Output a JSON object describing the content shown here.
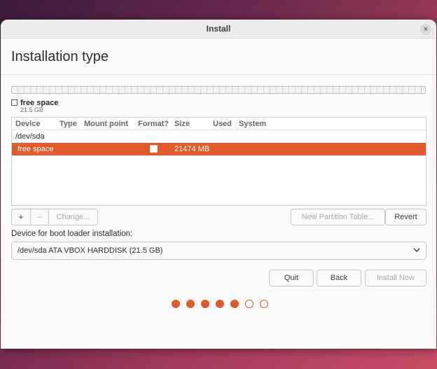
{
  "window": {
    "title": "Install",
    "close_glyph": "×"
  },
  "page": {
    "title": "Installation type"
  },
  "disk_legend": {
    "label": "free space",
    "size": "21.5 GB"
  },
  "partition_table": {
    "columns": [
      "Device",
      "Type",
      "Mount point",
      "Format?",
      "Size",
      "Used",
      "System"
    ],
    "device": "/dev/sda",
    "rows": [
      {
        "device": "free space",
        "type": "",
        "mount_point": "",
        "format": false,
        "size": "21474 MB",
        "used": "",
        "system": "",
        "selected": true
      }
    ]
  },
  "partition_buttons": {
    "add": "+",
    "remove": "–",
    "change": "Change...",
    "new_table": "New Partition Table...",
    "revert": "Revert"
  },
  "boot_loader": {
    "label": "Device for boot loader installation:",
    "selected": "/dev/sda ATA VBOX HARDDISK (21.5 GB)",
    "chevron_icon": "chevron-down-icon"
  },
  "nav_buttons": {
    "quit": "Quit",
    "back": "Back",
    "install_now": "Install Now"
  },
  "progress": {
    "total_steps": 7,
    "completed_steps": 5
  },
  "colors": {
    "accent": "#e05a2b",
    "window_bg": "#fafafa"
  }
}
